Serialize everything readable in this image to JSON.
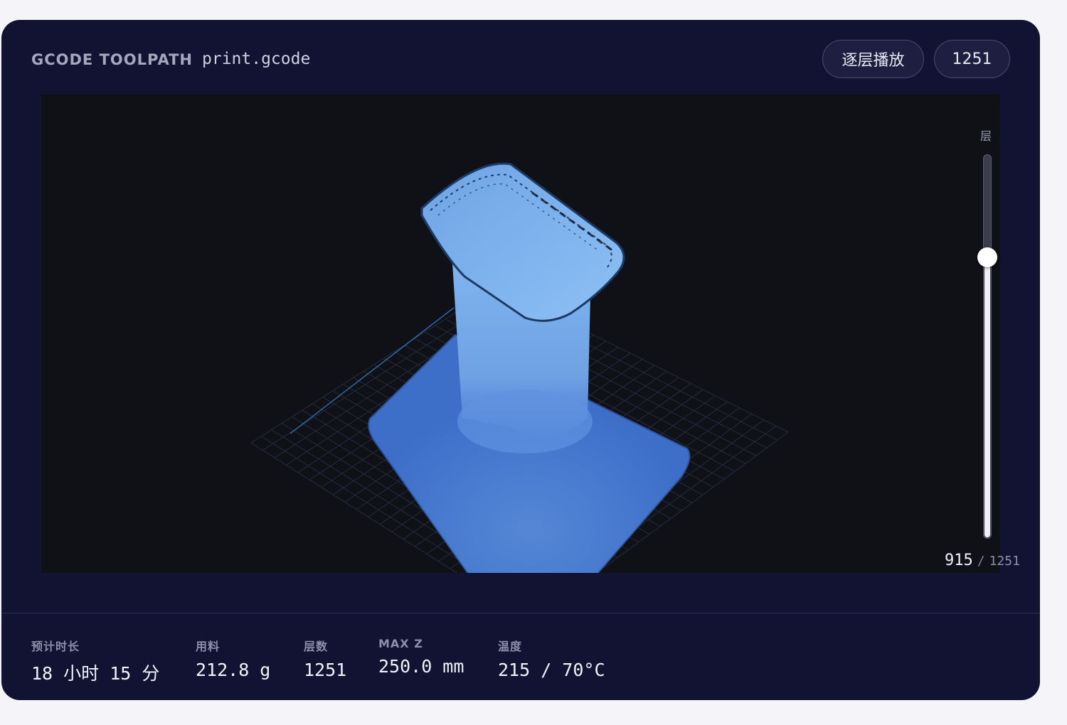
{
  "header": {
    "title": "GCODE TOOLPATH",
    "file_name": "print.gcode",
    "play_label": "逐层播放",
    "layer_count_pill": "1251"
  },
  "viewer": {
    "slider_label": "层",
    "current_layer": "915",
    "separator": "/",
    "total_layers": "1251",
    "layer_progress": 0.7314,
    "toolpath_color": "#4a7fd6",
    "background_color": "#0f1117"
  },
  "stats": [
    {
      "label": "预计时长",
      "value": "18 小时 15 分"
    },
    {
      "label": "用料",
      "value": "212.8 g"
    },
    {
      "label": "层数",
      "value": "1251"
    },
    {
      "label": "MAX Z",
      "value": "250.0 mm"
    },
    {
      "label": "温度",
      "value": "215 / 70°C"
    }
  ],
  "colors": {
    "panel": "#121233",
    "page": "#f5f5f9",
    "accent": "#4a7fd6"
  }
}
